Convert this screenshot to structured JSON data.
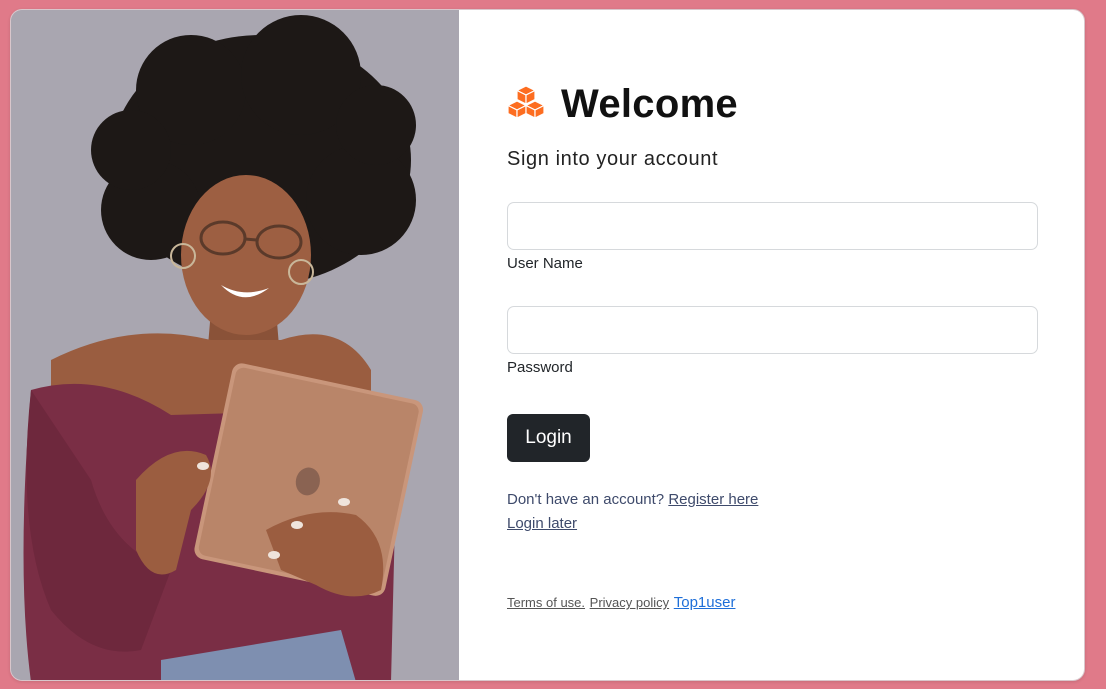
{
  "colors": {
    "page_bg": "#e07a89",
    "accent": "#fd6d20",
    "button_bg": "#212529",
    "link": "#3e4a6b",
    "brand_link": "#1e6fd9"
  },
  "hero": {
    "image": "woman-with-tablet-photo"
  },
  "brand": {
    "icon": "boxes-icon",
    "title": "Welcome"
  },
  "subtitle": "Sign into your account",
  "form": {
    "username": {
      "label": "User Name",
      "value": "",
      "placeholder": ""
    },
    "password": {
      "label": "Password",
      "value": "",
      "placeholder": ""
    },
    "login_label": "Login"
  },
  "links": {
    "register_prompt": "Don't have an account?",
    "register_link": "Register here",
    "login_later": "Login later"
  },
  "footer": {
    "terms": "Terms of use.",
    "privacy": "Privacy policy",
    "brand": "Top1user"
  }
}
